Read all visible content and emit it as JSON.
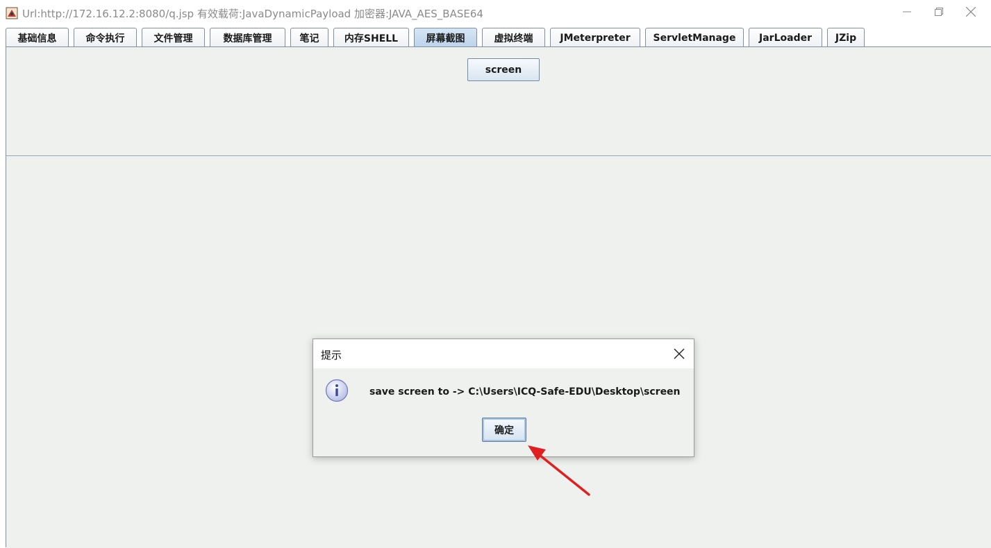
{
  "window": {
    "title": "Url:http://172.16.12.2:8080/q.jsp 有效载荷:JavaDynamicPayload 加密器:JAVA_AES_BASE64",
    "minimize_icon": "minimize-icon",
    "maximize_icon": "restore-icon",
    "close_icon": "close-icon"
  },
  "tabs": [
    {
      "label": "基础信息"
    },
    {
      "label": "命令执行"
    },
    {
      "label": "文件管理"
    },
    {
      "label": "数据库管理"
    },
    {
      "label": "笔记"
    },
    {
      "label": "内存SHELL"
    },
    {
      "label": "屏幕截图",
      "active": true
    },
    {
      "label": "虚拟终端"
    },
    {
      "label": "JMeterpreter"
    },
    {
      "label": "ServletManage"
    },
    {
      "label": "JarLoader"
    },
    {
      "label": "JZip"
    }
  ],
  "toolbar": {
    "screen_label": "screen"
  },
  "dialog": {
    "title": "提示",
    "message": "save screen to -> C:\\Users\\ICQ-Safe-EDU\\Desktop\\screen",
    "ok_label": "确定",
    "icon": "info-icon"
  },
  "colors": {
    "active_tab": "#bcd3ea",
    "panel_bg": "#eef1ee",
    "annotation_arrow": "#e02020"
  }
}
